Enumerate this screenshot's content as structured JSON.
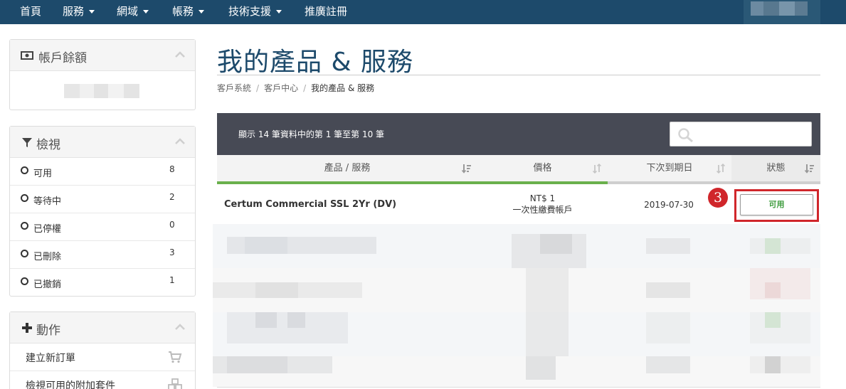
{
  "nav": {
    "items": [
      {
        "label": "首頁",
        "has_caret": false
      },
      {
        "label": "服務",
        "has_caret": true
      },
      {
        "label": "網域",
        "has_caret": true
      },
      {
        "label": "帳務",
        "has_caret": true
      },
      {
        "label": "技術支援",
        "has_caret": true
      },
      {
        "label": "推廣註冊",
        "has_caret": false
      }
    ]
  },
  "sidebar": {
    "balance": {
      "title": "帳戶餘額",
      "icon": "money-icon"
    },
    "view": {
      "title": "檢視",
      "icon": "filter-icon",
      "items": [
        {
          "label": "可用",
          "count": "8"
        },
        {
          "label": "等待中",
          "count": "2"
        },
        {
          "label": "已停權",
          "count": "0"
        },
        {
          "label": "已刪除",
          "count": "3"
        },
        {
          "label": "已撤銷",
          "count": "1"
        }
      ]
    },
    "actions": {
      "title": "動作",
      "icon": "plus-icon",
      "items": [
        {
          "label": "建立新訂單",
          "icon": "cart-icon"
        },
        {
          "label": "檢視可用的附加套件",
          "icon": "cubes-icon"
        }
      ]
    }
  },
  "main": {
    "title": "我的產品 & 服務",
    "breadcrumb": [
      "客戶系統",
      "客戶中心",
      "我的產品 & 服務"
    ],
    "table": {
      "info": "顯示 14 筆資料中的第 1 筆至第 10 筆",
      "search_placeholder": "",
      "columns": [
        {
          "label": "產品 / 服務"
        },
        {
          "label": "價格"
        },
        {
          "label": "下次到期日"
        },
        {
          "label": "狀態"
        }
      ],
      "rows": [
        {
          "product": "Certum Commercial SSL 2Yr (DV)",
          "price": "NT$ 1",
          "billing_cycle": "一次性繳費帳戶",
          "next_due": "2019-07-30",
          "status": "可用"
        }
      ]
    },
    "annotation_marker": "3"
  },
  "colors": {
    "nav_bg": "#1d4a6b",
    "table_bar_bg": "#474a55",
    "status_active": "#3c9b3c",
    "highlight_red": "#d0262b",
    "sort_bar_green": "#6ab04c",
    "sort_bar_grey": "#cfcfcf"
  }
}
